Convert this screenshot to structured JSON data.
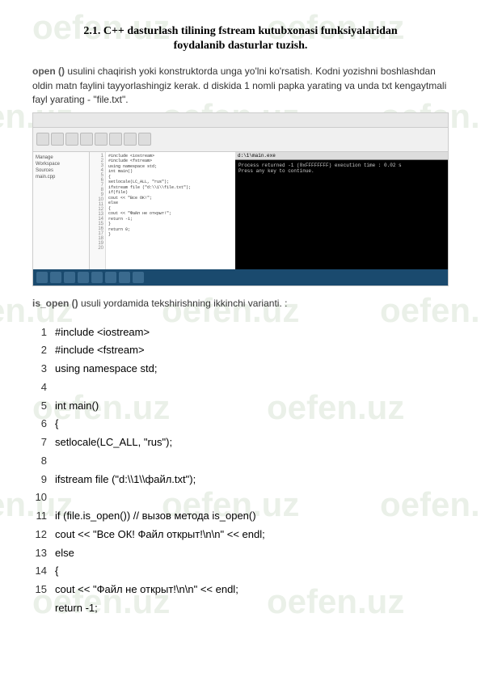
{
  "watermark": "oefen.uz",
  "heading_num": "2.1.",
  "heading_line1": "C++ dasturlash tilining fstream kutubxonasi funksiyalaridan",
  "heading_line2": "foydalanib dasturlar tuzish.",
  "para_kw": "open ()",
  "para_text": " usulini chaqirish yoki konstruktorda unga yo'lni ko'rsatish. Kodni yozishni boshlashdan oldin matn faylini tayyorlashingiz kerak. d diskida 1 nomli papka yarating va unda txt kengaytmali fayl yarating - \"file.txt\".",
  "ss": {
    "side_title": "Manage",
    "side_items": [
      "Workspace",
      "Sources",
      "main.cpp"
    ],
    "gutter": [
      "1",
      "2",
      "3",
      "4",
      "5",
      "6",
      "7",
      "8",
      "9",
      "10",
      "11",
      "12",
      "13",
      "14",
      "15",
      "16",
      "17",
      "18",
      "19",
      "20"
    ],
    "code_lines": [
      "#include <iostream>",
      "#include <fstream>",
      "using namespace std;",
      "",
      "int main()",
      "{",
      "  setlocale(LC_ALL, \"rus\");",
      "",
      "  ifstream file (\"d:\\\\1\\\\file.txt\");",
      "",
      "  if(file)",
      "    cout << \"Все ОК!\";",
      "  else",
      "  {",
      "    cout << \"Файл не открыт!\";",
      "    return -1;",
      "  }",
      "",
      "  return 0;",
      "}"
    ],
    "term_title": "d:\\1\\main.exe",
    "term_lines": [
      "Process returned -1 (0xFFFFFFFF)   execution time : 0.02 s",
      "Press any key to continue."
    ]
  },
  "para2_kw": "is_open ()",
  "para2_text": " usuli yordamida tekshirishning ikkinchi varianti. :",
  "code": [
    {
      "n": "1",
      "t": "#include <iostream>"
    },
    {
      "n": "2",
      "t": "#include <fstream>"
    },
    {
      "n": "3",
      "t": "using namespace std;"
    },
    {
      "n": "4",
      "t": ""
    },
    {
      "n": "5",
      "t": "int main()"
    },
    {
      "n": "6",
      "t": "{"
    },
    {
      "n": "7",
      "t": "setlocale(LC_ALL, \"rus\");"
    },
    {
      "n": "8",
      "t": ""
    },
    {
      "n": "9",
      "t": "ifstream file (\"d:\\\\1\\\\файл.txt\");"
    },
    {
      "n": "10",
      "t": ""
    },
    {
      "n": "11",
      "t": "if (file.is_open()) // вызов метода is_open()"
    },
    {
      "n": "12",
      "t": "cout << \"Все ОК! Файл открыт!\\n\\n\" << endl;"
    },
    {
      "n": "13",
      "t": "else"
    },
    {
      "n": "14",
      "t": "{"
    },
    {
      "n": "15",
      "t": "cout << \"Файл не открыт!\\n\\n\" << endl;"
    },
    {
      "n": "",
      "t": "return -1;"
    }
  ]
}
